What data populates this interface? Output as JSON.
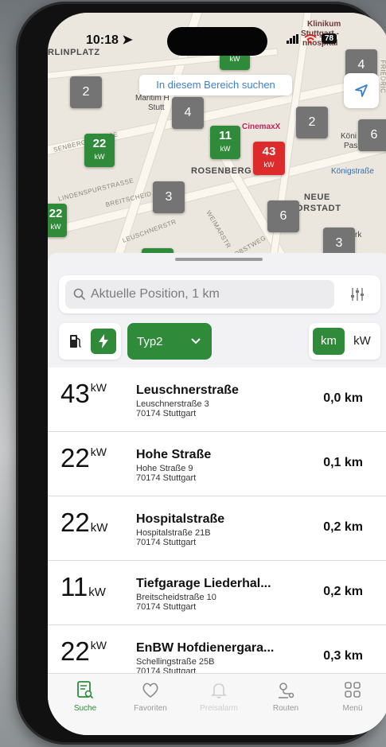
{
  "status_bar": {
    "time": "10:18",
    "battery": "78"
  },
  "map": {
    "search_area_label": "In diesem Bereich suchen",
    "area_labels": [
      "RLINPLATZ",
      "ROSENBERG",
      "NEUE",
      "ORSTADT"
    ],
    "poi_labels": [
      "Klinikum",
      "Stuttgart -",
      "nhospital",
      "CinemaxX",
      "Maritim H",
      "Stutt",
      "Königstraße",
      "Köni",
      "Pas",
      "rk"
    ],
    "street_labels": [
      "SENBERGSTRASSE",
      "LINDENSPURSTRASSE",
      "BREITSCHEID",
      "LEUSCHNERSTR",
      "WEIMARSTR",
      "JOBSTWEG",
      "FRIEDRIC"
    ],
    "markers": [
      {
        "kind": "grey",
        "count": "2"
      },
      {
        "kind": "grey",
        "count": "4"
      },
      {
        "kind": "grey",
        "count": "2"
      },
      {
        "kind": "grey",
        "count": "4"
      },
      {
        "kind": "grey",
        "count": "6"
      },
      {
        "kind": "grey",
        "count": "3"
      },
      {
        "kind": "grey",
        "count": "6"
      },
      {
        "kind": "grey",
        "count": "3"
      },
      {
        "kind": "green",
        "value": "22",
        "unit": "kW"
      },
      {
        "kind": "green",
        "value": "11",
        "unit": "kW"
      },
      {
        "kind": "red",
        "value": "43",
        "unit": "kW"
      },
      {
        "kind": "green",
        "value": "22",
        "unit": "kW"
      },
      {
        "kind": "green",
        "value": "",
        "unit": "kW"
      }
    ],
    "colors": {
      "green": "#2f8a3a",
      "red": "#dd2a2a",
      "grey": "#747474"
    }
  },
  "search": {
    "placeholder": "Aktuelle Position, 1 km"
  },
  "filters": {
    "plug_type": "Typ2",
    "sort_km": "km",
    "sort_kw": "kW"
  },
  "stations": [
    {
      "power": "43",
      "unit": "kW",
      "unit_style": "sup",
      "name": "Leuschnerstraße",
      "street": "Leuschnerstraße 3",
      "city": "70174 Stuttgart",
      "distance": "0,0 km"
    },
    {
      "power": "22",
      "unit": "kW",
      "unit_style": "sup",
      "name": "Hohe Straße",
      "street": "Hohe Straße 9",
      "city": "70174 Stuttgart",
      "distance": "0,1 km"
    },
    {
      "power": "22",
      "unit": "kW",
      "unit_style": "sub",
      "name": "Hospitalstraße",
      "street": "Hospitalstraße 21B",
      "city": "70174 Stuttgart",
      "distance": "0,2 km"
    },
    {
      "power": "11",
      "unit": "kW",
      "unit_style": "sub",
      "name": "Tiefgarage Liederhal...",
      "street": "Breitscheidstraße 10",
      "city": "70174 Stuttgart",
      "distance": "0,2 km"
    },
    {
      "power": "22",
      "unit": "kW",
      "unit_style": "sup",
      "name": "EnBW Hofdienergara...",
      "street": "Schellingstraße 25B",
      "city": "70174 Stuttgart",
      "distance": "0,3 km"
    }
  ],
  "tabs": [
    {
      "label": "Suche",
      "icon": "search-list-icon",
      "state": "active"
    },
    {
      "label": "Favoriten",
      "icon": "heart-icon",
      "state": "normal"
    },
    {
      "label": "Preisalarm",
      "icon": "bell-icon",
      "state": "disabled"
    },
    {
      "label": "Routen",
      "icon": "route-icon",
      "state": "normal"
    },
    {
      "label": "Menü",
      "icon": "grid-icon",
      "state": "normal"
    }
  ]
}
